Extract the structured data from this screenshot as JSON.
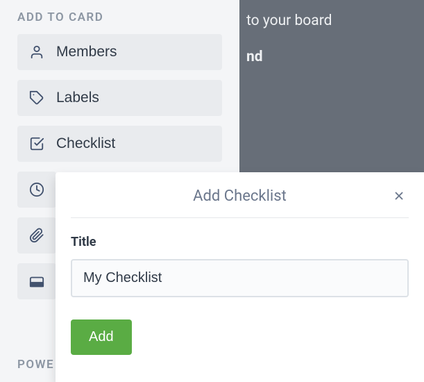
{
  "sidebar": {
    "section_title": "ADD TO CARD",
    "items": [
      {
        "label": "Members",
        "icon": "user-icon"
      },
      {
        "label": "Labels",
        "icon": "tag-icon"
      },
      {
        "label": "Checklist",
        "icon": "check-square-icon"
      },
      {
        "label": "",
        "icon": "clock-icon"
      },
      {
        "label": "",
        "icon": "paperclip-icon"
      },
      {
        "label": "",
        "icon": "card-icon"
      }
    ],
    "power_title": "POWE"
  },
  "backdrop": {
    "line1": "to your board",
    "line2": "nd"
  },
  "popover": {
    "title": "Add Checklist",
    "field_label": "Title",
    "input_value": "My Checklist",
    "add_label": "Add"
  }
}
